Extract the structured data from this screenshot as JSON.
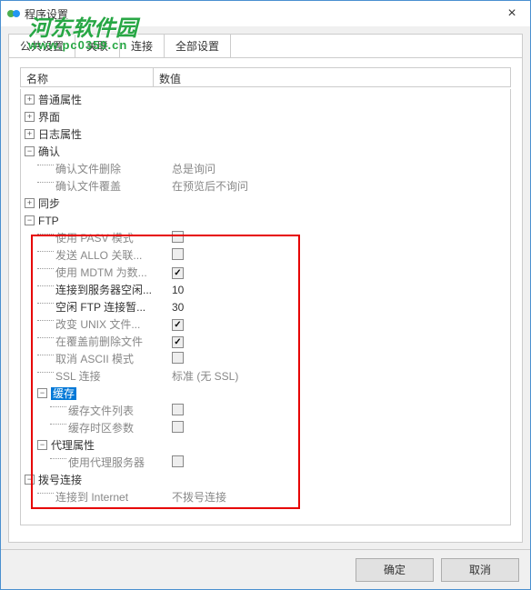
{
  "window": {
    "title": "程序设置",
    "close_icon": "×"
  },
  "watermark": {
    "line1": "河东软件园",
    "line2": "www.pc0359.cn"
  },
  "tabs": {
    "public": "公共设置",
    "assoc": "关联",
    "connect": "连接",
    "all": "全部设置"
  },
  "columns": {
    "name": "名称",
    "value": "数值"
  },
  "tree": {
    "normal_props": "普通属性",
    "interface": "界面",
    "log_props": "日志属性",
    "confirm": "确认",
    "confirm_delete": "确认文件删除",
    "confirm_delete_val": "总是询问",
    "confirm_overwrite": "确认文件覆盖",
    "confirm_overwrite_val": "在预览后不询问",
    "sync": "同步",
    "ftp": "FTP",
    "use_pasv": "使用 PASV 模式",
    "send_allo": "发送 ALLO 关联...",
    "use_mdtm": "使用 MDTM 为数...",
    "conn_idle": "连接到服务器空闲...",
    "conn_idle_val": "10",
    "idle_ftp": "空闲 FTP 连接暂...",
    "idle_ftp_val": "30",
    "change_unix": "改变 UNIX 文件...",
    "del_before": "在覆盖前删除文件",
    "cancel_ascii": "取消 ASCII 模式",
    "ssl_conn": "SSL 连接",
    "ssl_conn_val": "标准 (无 SSL)",
    "cache": "缓存",
    "cache_file_list": "缓存文件列表",
    "cache_tz": "缓存时区参数",
    "proxy_props": "代理属性",
    "use_proxy": "使用代理服务器",
    "dial": "拨号连接",
    "conn_internet": "连接到 Internet",
    "conn_internet_val": "不拨号连接"
  },
  "buttons": {
    "ok": "确定",
    "cancel": "取消"
  }
}
